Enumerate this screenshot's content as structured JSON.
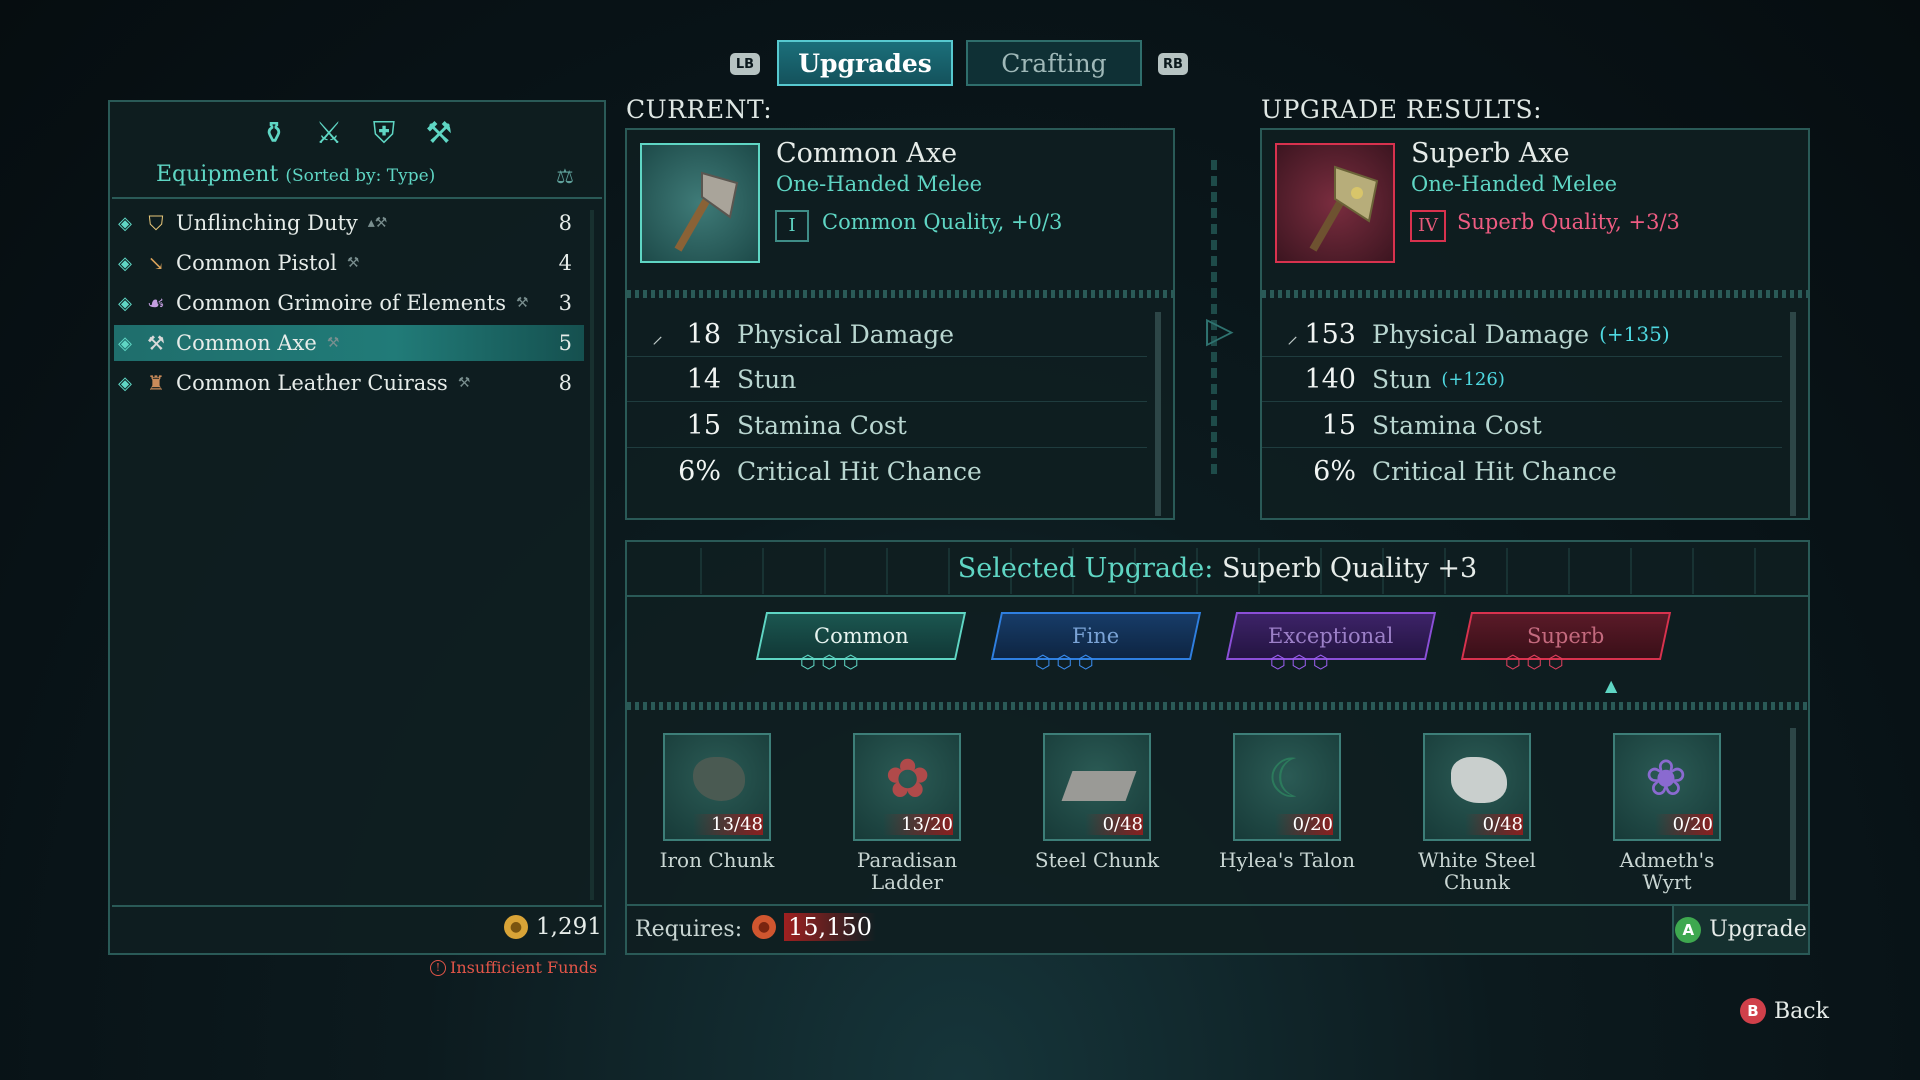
{
  "tabs": {
    "left_bumper": "LB",
    "right_bumper": "RB",
    "upgrades": "Upgrades",
    "crafting": "Crafting"
  },
  "equipment": {
    "title": "Equipment",
    "sorted_by": "(Sorted by: Type)",
    "filter_icons": [
      "all-gear-icon",
      "weapons-icon",
      "armor-icon",
      "anvil-icon"
    ],
    "items": [
      {
        "name": "Unflinching Duty",
        "count": "8",
        "icon": "shield-icon"
      },
      {
        "name": "Common Pistol",
        "count": "4",
        "icon": "pistol-icon"
      },
      {
        "name": "Common Grimoire of Elements",
        "count": "3",
        "icon": "grimoire-icon"
      },
      {
        "name": "Common Axe",
        "count": "5",
        "icon": "axe-icon",
        "selected": true
      },
      {
        "name": "Common Leather Cuirass",
        "count": "8",
        "icon": "cuirass-icon"
      }
    ],
    "gold": "1,291",
    "warning": "Insufficient Funds"
  },
  "current": {
    "label": "CURRENT:",
    "name": "Common Axe",
    "type": "One-Handed Melee",
    "tier_numeral": "I",
    "quality": "Common Quality, +0/3",
    "stats": [
      {
        "value": "18",
        "label": "Physical Damage"
      },
      {
        "value": "14",
        "label": "Stun"
      },
      {
        "value": "15",
        "label": "Stamina Cost"
      },
      {
        "value": "6%",
        "label": "Critical Hit Chance"
      }
    ]
  },
  "result": {
    "label": "UPGRADE RESULTS:",
    "name": "Superb Axe",
    "type": "One-Handed Melee",
    "tier_numeral": "IV",
    "quality": "Superb Quality, +3/3",
    "stats": [
      {
        "value": "153",
        "label": "Physical Damage",
        "delta": "(+135)"
      },
      {
        "value": "140",
        "label": "Stun",
        "delta": "(+126)"
      },
      {
        "value": "15",
        "label": "Stamina Cost"
      },
      {
        "value": "6%",
        "label": "Critical Hit Chance"
      }
    ]
  },
  "selected_upgrade": {
    "prefix": "Selected Upgrade:",
    "value": "Superb Quality +3"
  },
  "tiers": [
    {
      "name": "Common",
      "color": "#5fd6c4"
    },
    {
      "name": "Fine",
      "color": "#2f7fe0"
    },
    {
      "name": "Exceptional",
      "color": "#8b4fd8"
    },
    {
      "name": "Superb",
      "color": "#d8324e"
    }
  ],
  "materials": [
    {
      "name": "Iron Chunk",
      "qty": "13/48"
    },
    {
      "name": "Paradisan Ladder",
      "qty": "13/20"
    },
    {
      "name": "Steel Chunk",
      "qty": "0/48"
    },
    {
      "name": "Hylea's Talon",
      "qty": "0/20"
    },
    {
      "name": "White Steel Chunk",
      "qty": "0/48"
    },
    {
      "name": "Admeth's Wyrt",
      "qty": "0/20"
    }
  ],
  "requires": {
    "label": "Requires:",
    "cost": "15,150"
  },
  "actions": {
    "upgrade_key": "A",
    "upgrade": "Upgrade",
    "back_key": "B",
    "back": "Back"
  }
}
